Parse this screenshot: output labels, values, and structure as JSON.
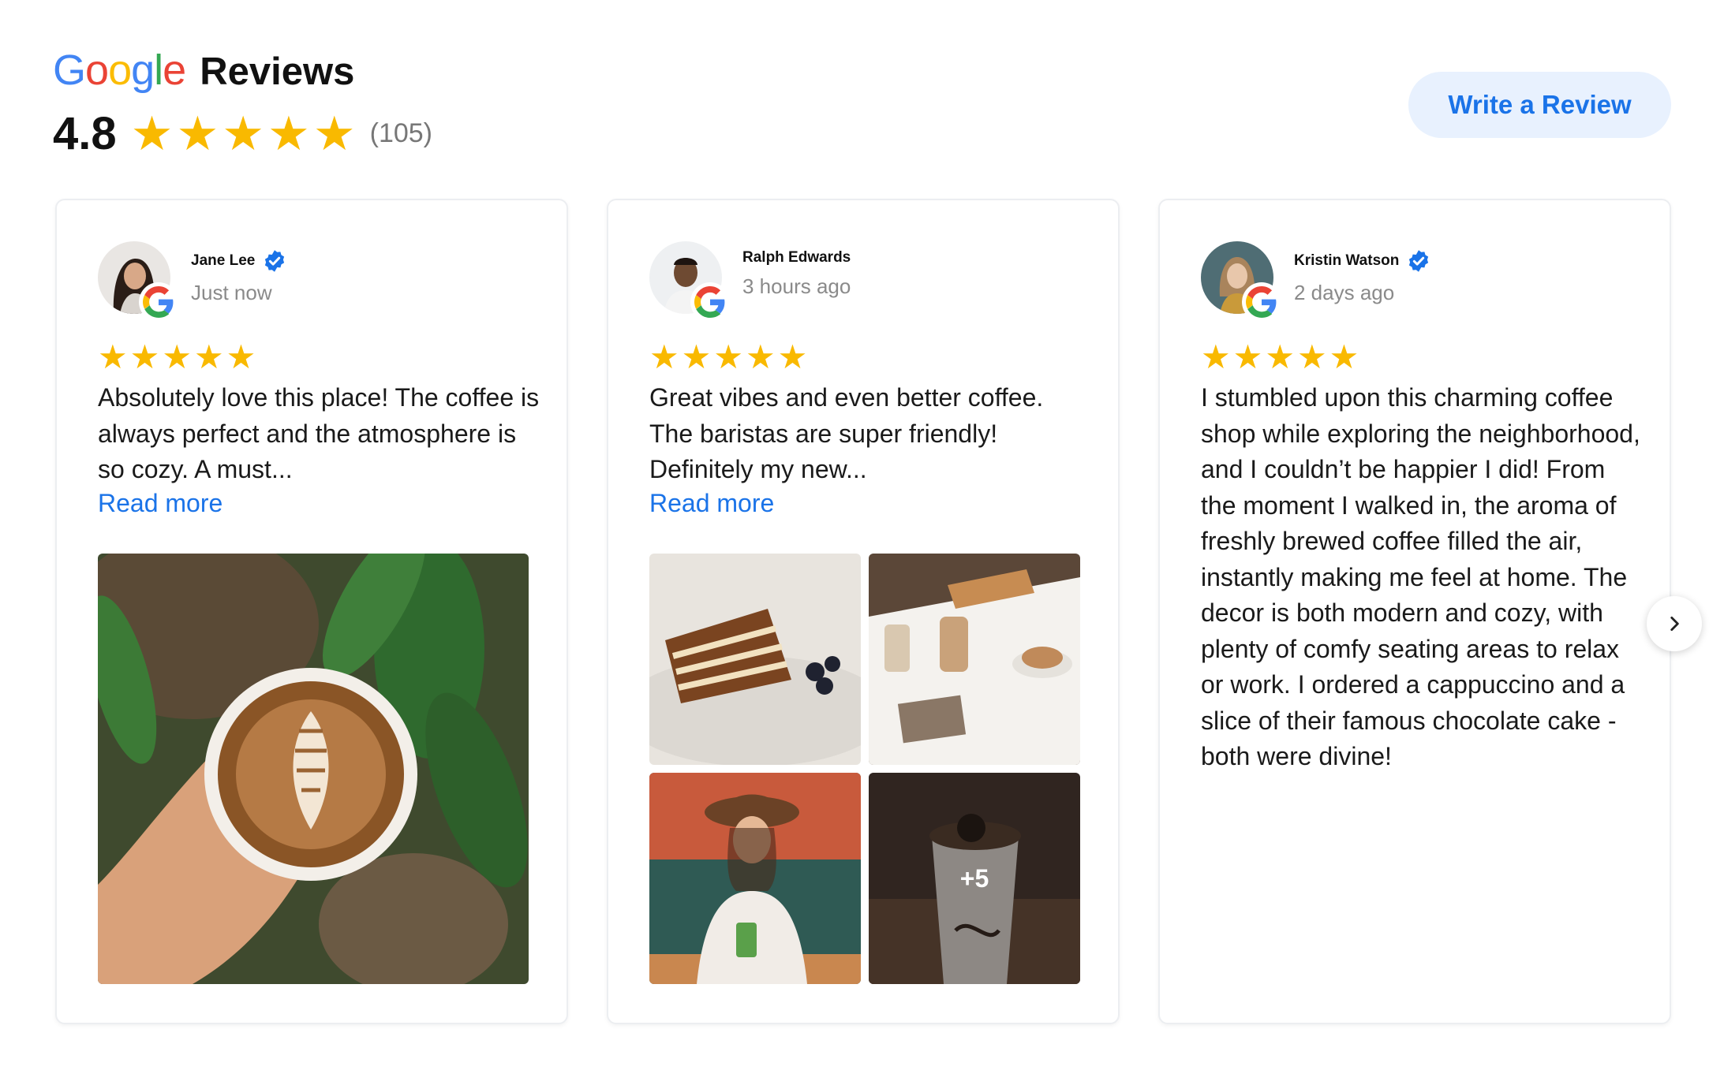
{
  "header": {
    "brand_letters": [
      {
        "ch": "G",
        "color": "#4285F4"
      },
      {
        "ch": "o",
        "color": "#EA4335"
      },
      {
        "ch": "o",
        "color": "#FBBC05"
      },
      {
        "ch": "g",
        "color": "#4285F4"
      },
      {
        "ch": "l",
        "color": "#34A853"
      },
      {
        "ch": "e",
        "color": "#EA4335"
      }
    ],
    "brand_g1": "G",
    "brand_o1": "o",
    "brand_o2": "o",
    "brand_g2": "g",
    "brand_l": "l",
    "brand_e": "e",
    "reviews_word": "Reviews",
    "rating": "4.8",
    "stars": 5,
    "count": "(105)",
    "write_review_label": "Write a Review"
  },
  "reviews": [
    {
      "name": "Jane Lee",
      "verified": true,
      "time": "Just now",
      "stars": 5,
      "text": "Absolutely love this place! The coffee is always perfect and the atmosphere is so cozy. A must...",
      "read_more": "Read more",
      "photos": 1
    },
    {
      "name": "Ralph Edwards",
      "verified": false,
      "time": "3 hours ago",
      "stars": 5,
      "text": "Great vibes and even better coffee. The baristas are super friendly! Definitely my new...",
      "read_more": "Read more",
      "photos": 4,
      "more_photos_label": "+5"
    },
    {
      "name": "Kristin Watson",
      "verified": true,
      "time": "2 days ago",
      "stars": 5,
      "text": "I stumbled upon this charming coffee shop while exploring the neighborhood, and I couldn’t be happier I did! From the moment I walked in, the aroma of freshly brewed coffee filled the air, instantly making me feel at home. The decor is both modern and cozy, with plenty of comfy seating areas to relax or work. I ordered a cappuccino and a slice of their famous chocolate cake - both were divine!"
    }
  ],
  "star_glyph": "★",
  "colors": {
    "star": "#F9B900",
    "link": "#1A73E8",
    "button_bg": "#E8F1FE",
    "verified": "#1A73E8"
  },
  "icons": {
    "next": "chevron-right-icon",
    "verified": "verified-check-icon",
    "google": "google-g-icon"
  }
}
